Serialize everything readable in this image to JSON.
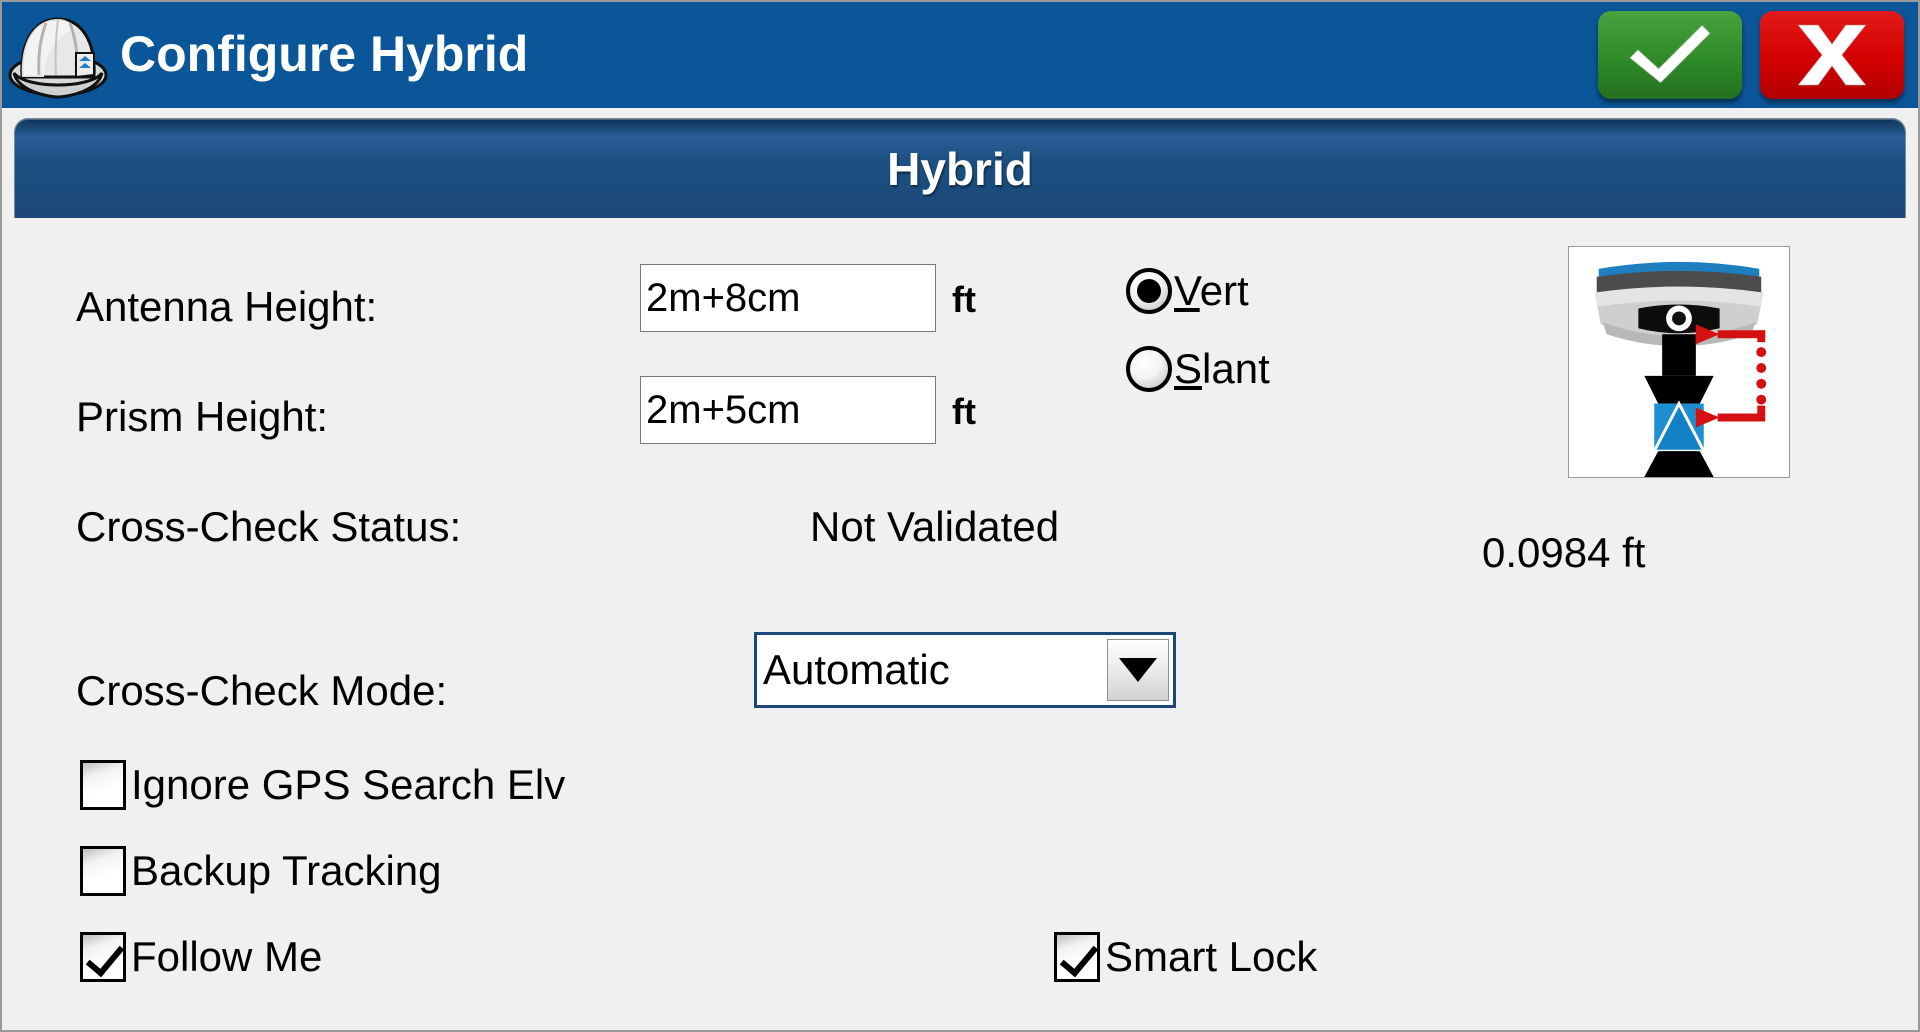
{
  "window": {
    "title": "Configure Hybrid",
    "icon": "hard-hat-icon",
    "accent_blue": "#0a5699",
    "panel_navy": "#1b4878",
    "body_gray": "#f0f0f0"
  },
  "titlebar_buttons": {
    "ok": {
      "label": "",
      "icon": "checkmark-icon",
      "color": "#2e8b27"
    },
    "cancel": {
      "label": "",
      "icon": "x-icon",
      "color": "#d40000"
    }
  },
  "panel": {
    "header_title": "Hybrid"
  },
  "fields": {
    "antenna_height": {
      "label": "Antenna Height:",
      "value": "2m+8cm",
      "placeholder": "",
      "unit": "ft"
    },
    "prism_height": {
      "label": "Prism Height:",
      "value": "2m+5cm",
      "placeholder": "",
      "unit": "ft"
    },
    "cross_check_status": {
      "label": "Cross-Check Status:",
      "value": "Not Validated"
    },
    "cross_check_mode": {
      "label": "Cross-Check Mode:",
      "value": "Automatic",
      "options": [
        "Automatic"
      ]
    }
  },
  "height_mode": {
    "selected": "Vert",
    "options": [
      {
        "label": "Vert",
        "accelerator": "V",
        "rest": "ert",
        "checked": true
      },
      {
        "label": "Slant",
        "accelerator": "S",
        "rest": "lant",
        "checked": false
      }
    ]
  },
  "checkboxes": [
    {
      "label": "Ignore GPS Search Elv",
      "checked": false
    },
    {
      "label": "Backup Tracking",
      "checked": false
    },
    {
      "label": "Follow Me",
      "checked": true
    },
    {
      "label": "Smart Lock",
      "checked": true
    }
  ],
  "device_graphic": {
    "name": "gnss-receiver-prism-offset-diagram",
    "offset_value": "0.0984 ft"
  }
}
